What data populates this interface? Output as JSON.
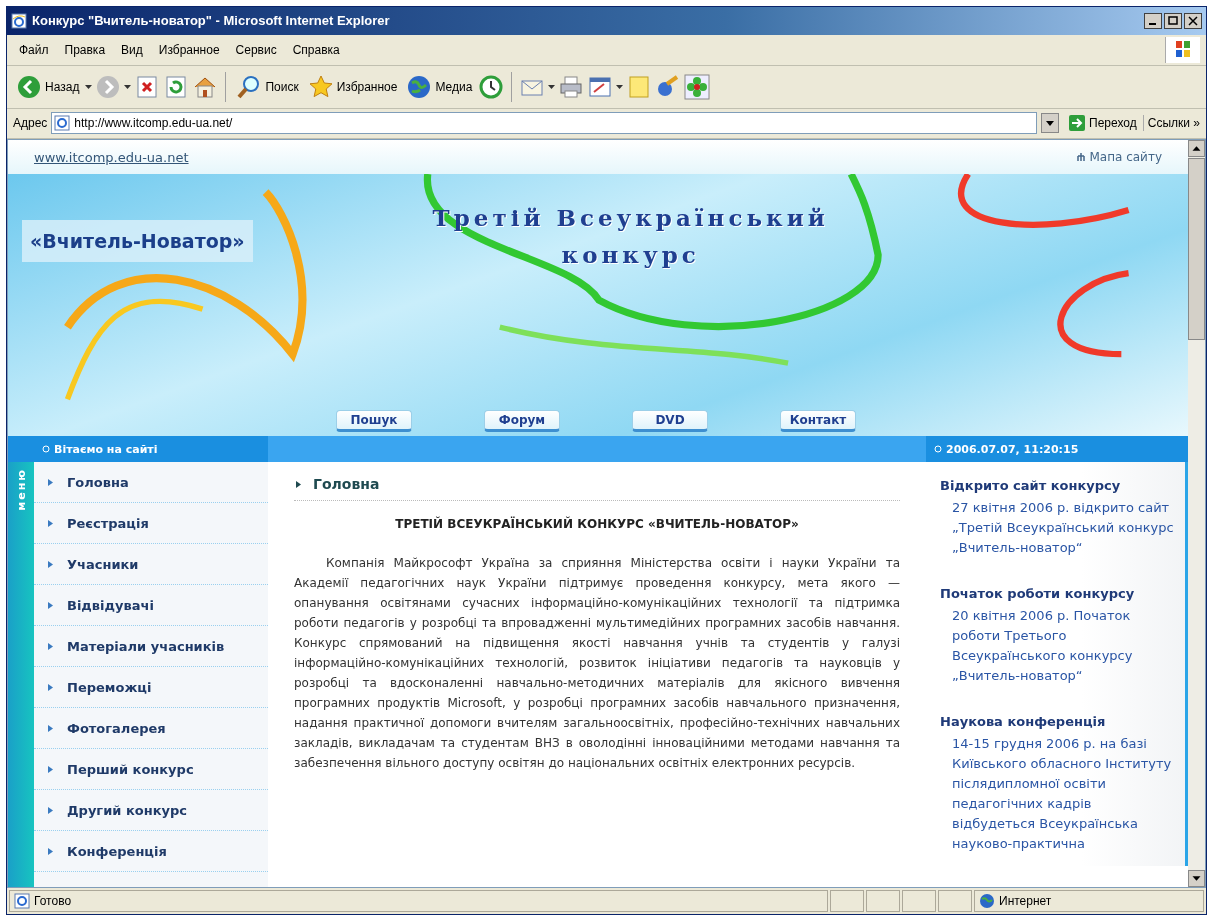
{
  "window": {
    "title": "Конкурс \"Вчитель-новатор\" - Microsoft Internet Explorer"
  },
  "menu_bar": [
    "Файл",
    "Правка",
    "Вид",
    "Избранное",
    "Сервис",
    "Справка"
  ],
  "toolbar": [
    {
      "kind": "button",
      "label": "Назад"
    },
    {
      "kind": "caret"
    },
    {
      "kind": "button"
    },
    {
      "kind": "caret"
    },
    {
      "kind": "button"
    },
    {
      "kind": "button"
    },
    {
      "kind": "button"
    },
    {
      "kind": "separator"
    },
    {
      "kind": "button",
      "label": "Поиск"
    },
    {
      "kind": "button",
      "label": "Избранное"
    },
    {
      "kind": "button",
      "label": "Медиа"
    },
    {
      "kind": "button"
    },
    {
      "kind": "separator"
    },
    {
      "kind": "button"
    },
    {
      "kind": "caret"
    },
    {
      "kind": "button"
    },
    {
      "kind": "button"
    },
    {
      "kind": "caret"
    },
    {
      "kind": "button"
    },
    {
      "kind": "button"
    },
    {
      "kind": "button"
    }
  ],
  "address_bar": {
    "label": "Адрес",
    "url": "http://www.itcomp.edu-ua.net/",
    "go_label": "Переход",
    "links_label": "Ссылки",
    "more": "»"
  },
  "page": {
    "site_link": "www.itcomp.edu-ua.net",
    "sitemap": "Мапа сайту",
    "banner": {
      "logo": "«Вчитель-Новатор»",
      "title_lines": [
        "Третій Всеукраїнський",
        "конкурс"
      ]
    },
    "nav": [
      "Пошук",
      "Форум",
      "DVD",
      "Контакт"
    ],
    "welcome": "Вітаємо на сайті",
    "datetime": "2006.07.07, 11:20:15",
    "menu_label": "меню",
    "menu": [
      "Головна",
      "Реєстрація",
      "Учасники",
      "Відвідувачі",
      "Матеріали учасників",
      "Переможці",
      "Фотогалерея",
      "Перший конкурс",
      "Другий конкурс",
      "Конференція"
    ],
    "breadcrumb": "Головна",
    "heading": "ТРЕТІЙ ВСЕУКРАЇНСЬКИЙ КОНКУРС «ВЧИТЕЛЬ-НОВАТОР»",
    "paragraph": "Компанія Майкрософт Україна за сприяння Міністерства освіти і науки України та Академії педагогічних наук України підтримує проведення конкурсу, мета якого — опанування освітянами сучасних інформаційно-комунікаційних технології та підтримка роботи педагогів у розробці та впровадженні мультимедійних програмних засобів навчання. Конкурс спрямований на підвищення якості навчання учнів та студентів у галузі інформаційно-комунікаційних технологій, розвиток ініціативи педагогів та науковців у розробці та вдосконаленні навчально-методичних матеріалів для якісного вивчення програмних продуктів Microsoft, у розробці програмних засобів навчального призначення, надання практичної допомоги вчителям загальноосвітніх, професійно-технічних навчальних закладів, викладачам та студентам ВНЗ в оволодінні інноваційними методами навчання та забезпечення вільного доступу освітян до національних освітніх електронних ресурсів.",
    "news": [
      {
        "title": "Відкрито сайт конкурсу",
        "text": "27 квітня 2006 р. відкрито сайт „Третій Всеукраїнський конкурс „Вчитель-новатор“"
      },
      {
        "title": "Початок роботи конкурсу",
        "text": "20 квітня 2006 р. Початок роботи Третього Всеукраїнського конкурсу „Вчитель-новатор“"
      },
      {
        "title": "Наукова конференція",
        "text": "14-15 грудня 2006 р. на базі Київського обласного Інституту післядипломної освіти педагогічних кадрів відбудеться Всеукраїнська науково-практична"
      }
    ]
  },
  "status_bar": {
    "text": "Готово",
    "zone": "Интернет"
  }
}
